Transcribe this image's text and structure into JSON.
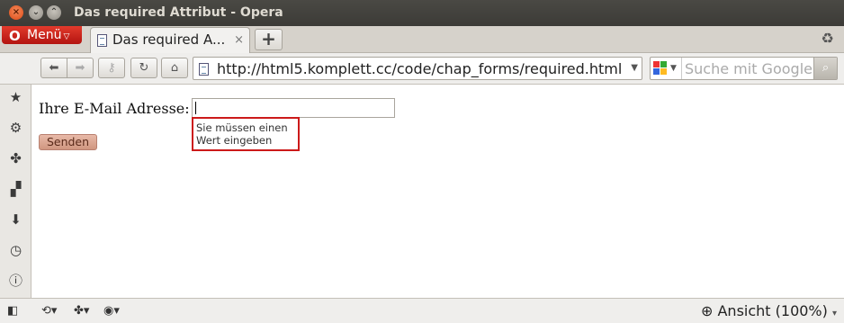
{
  "window": {
    "title": "Das required Attribut - Opera",
    "close_glyph": "×",
    "minimize_glyph": "⌄",
    "maximize_glyph": "⌃"
  },
  "menu": {
    "label": "Menü"
  },
  "tabs": [
    {
      "label": "Das required A...",
      "active": true
    }
  ],
  "toolbar": {
    "url": "http://html5.komplett.cc/code/chap_forms/required.html",
    "search_placeholder": "Suche mit Google"
  },
  "page": {
    "email_label": "Ihre E-Mail Adresse:",
    "email_value": "",
    "validation_message_line1": "Sie müssen einen",
    "validation_message_line2": "Wert eingeben",
    "submit_label": "Senden"
  },
  "statusbar": {
    "zoom_label": "Ansicht (100%)"
  },
  "colors": {
    "titlebar": "#3c3b37",
    "menu_button": "#c41d17",
    "validation_border": "#cc1a1a",
    "submit_button": "#dca690"
  }
}
